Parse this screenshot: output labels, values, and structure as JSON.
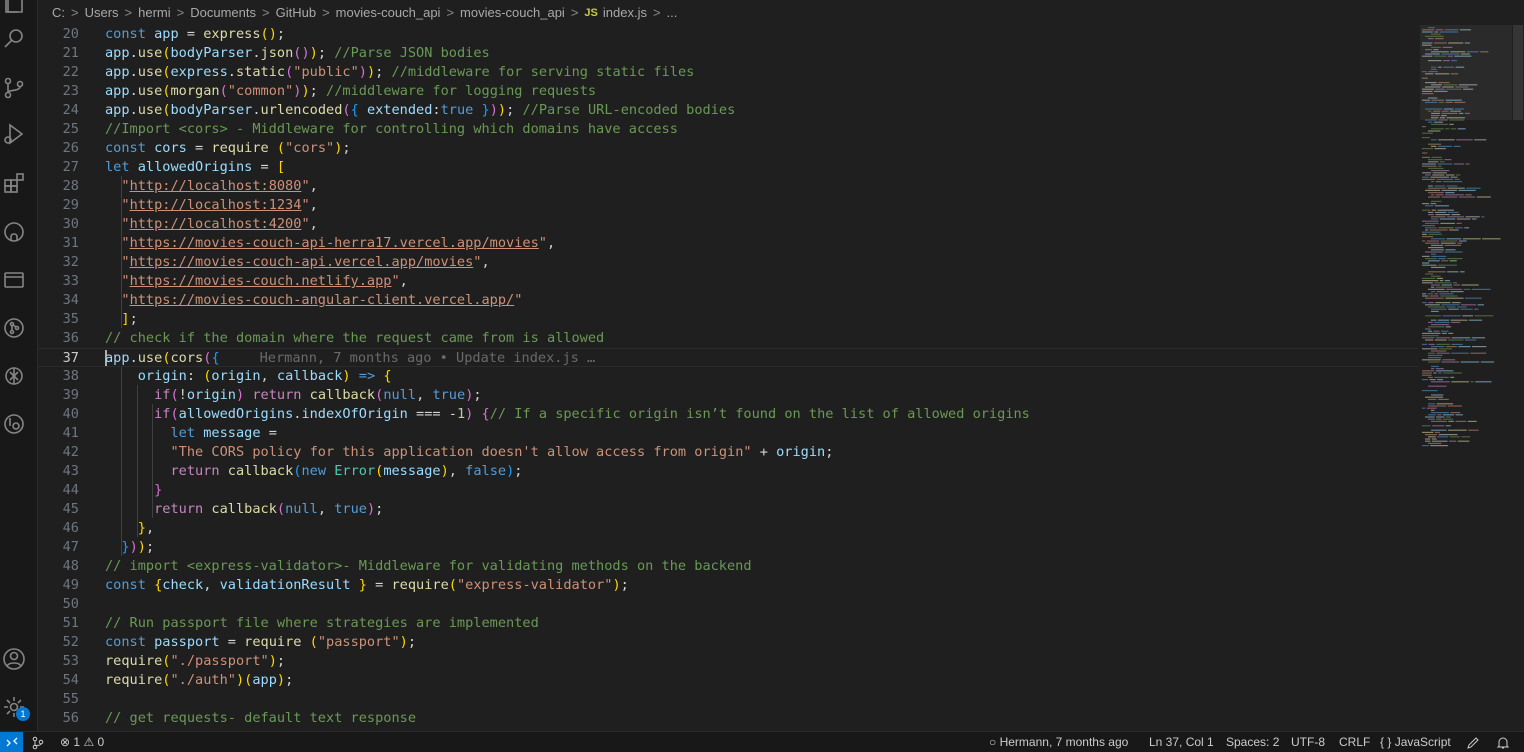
{
  "breadcrumb": {
    "items": [
      "C:",
      "Users",
      "hermi",
      "Documents",
      "GitHub",
      "movies-couch_api",
      "movies-couch_api"
    ],
    "file_icon": "JS",
    "file": "index.js",
    "symbol": "..."
  },
  "activity_bar": {
    "icons": [
      "explorer-icon",
      "search-icon",
      "source-control-icon",
      "run-debug-icon",
      "extensions-icon",
      "github-icon",
      "remote-explorer-icon",
      "git-graph-icon",
      "chatgpt-icon",
      "timeline-icon",
      "account-icon",
      "manage-gear-icon"
    ],
    "settings_badge": "1"
  },
  "editor": {
    "active_line": 37,
    "blame": "Hermann, 7 months ago • Update index.js …",
    "line_numbers": [
      "20",
      "21",
      "22",
      "23",
      "24",
      "25",
      "26",
      "27",
      "28",
      "29",
      "30",
      "31",
      "32",
      "33",
      "34",
      "35",
      "36",
      "37",
      "38",
      "39",
      "40",
      "41",
      "42",
      "43",
      "44",
      "45",
      "46",
      "47",
      "48",
      "49",
      "50",
      "51",
      "52",
      "53",
      "54",
      "55",
      "56"
    ]
  },
  "statusbar": {
    "problems_errors": "1",
    "problems_warnings": "0",
    "blame": "Hermann, 7 months ago",
    "position": "Ln 37, Col 1",
    "spaces": "Spaces: 2",
    "encoding": "UTF-8",
    "eol": "CRLF",
    "language": "JavaScript"
  },
  "colors": {
    "accent": "#0078d4",
    "background": "#1f1f1f",
    "comment": "#6a9955",
    "string": "#ce9178",
    "keyword": "#569cd6"
  }
}
